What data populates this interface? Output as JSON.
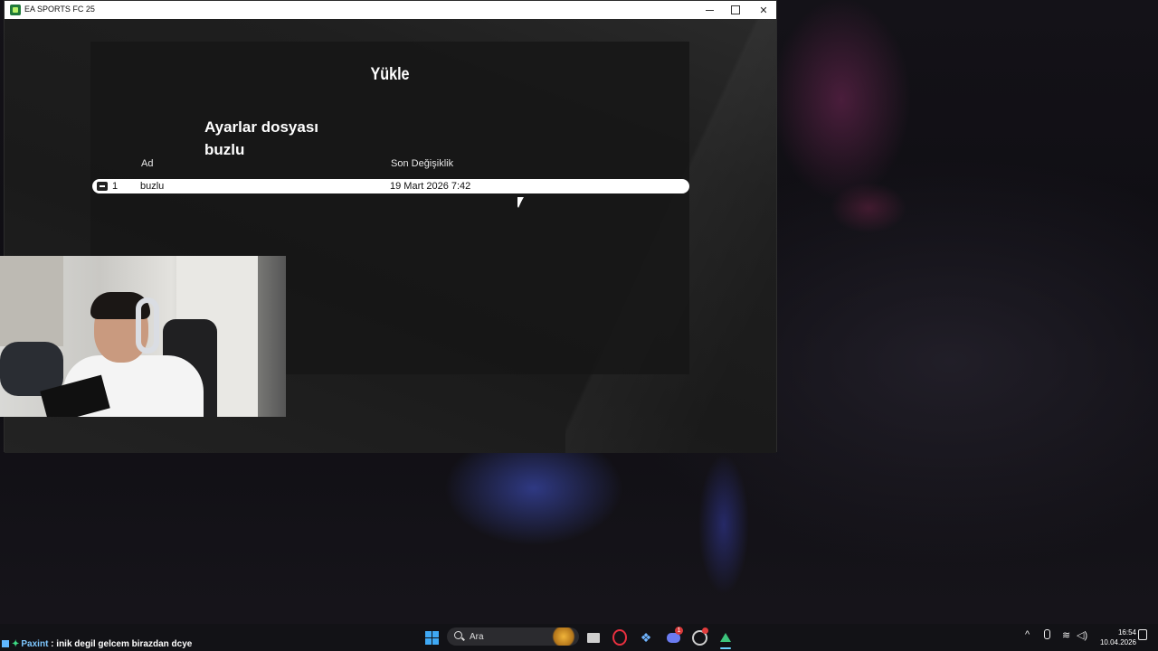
{
  "window": {
    "title": "EA SPORTS FC 25"
  },
  "load_panel": {
    "title": "Yükle",
    "subtitle_line1": "Ayarlar dosyası",
    "subtitle_line2": "buzlu",
    "columns": {
      "name": "Ad",
      "modified": "Son Değişiklik"
    },
    "rows": [
      {
        "index": "1",
        "name": "buzlu",
        "modified": "19 Mart 2026 7:42"
      }
    ]
  },
  "chat": {
    "user": "Paxint",
    "separator": " : ",
    "message": "inik degil gelcem birazdan dcye"
  },
  "taskbar": {
    "search_placeholder": "Ara",
    "discord_badge": "1",
    "clock_time": "16:54",
    "clock_date": "10.04.2026"
  },
  "icons": {
    "start": "windows-start-icon",
    "search": "search-icon",
    "files": "file-explorer-icon",
    "opera": "opera-gx-icon",
    "discord": "discord-icon",
    "ea": "ea-app-icon"
  },
  "colors": {
    "accent_blue": "#3fa9f5",
    "opera_red": "#e8303f",
    "discord_purple": "#6b7cf1",
    "ea_green": "#3cc47c",
    "chat_user": "#7ec8ff"
  }
}
